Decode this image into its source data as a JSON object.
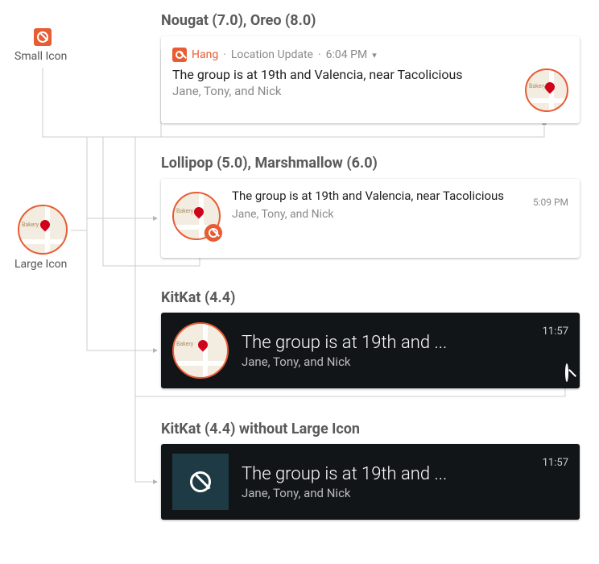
{
  "labels": {
    "small_icon": "Small Icon",
    "large_icon": "Large Icon"
  },
  "headings": {
    "nougat": "Nougat (7.0), Oreo (8.0)",
    "lollipop": "Lollipop (5.0), Marshmallow (6.0)",
    "kitkat": "KitKat (4.4)",
    "kitkat_no_large": "KitKat (4.4) without Large Icon"
  },
  "card_nougat": {
    "app_name": "Hang",
    "category": "Location Update",
    "time": "6:04 PM",
    "title": "The group is at 19th and Valencia, near Tacolicious",
    "subtitle": "Jane, Tony, and Nick",
    "sep": "·"
  },
  "card_lollipop": {
    "title": "The group is at 19th and Valencia, near Tacolicious",
    "subtitle": "Jane, Tony, and Nick",
    "time": "5:09 PM"
  },
  "card_kitkat": {
    "title": "The group is at 19th and ...",
    "subtitle": "Jane, Tony, and Nick",
    "time": "11:57"
  },
  "card_kitkat_no_large": {
    "title": "The group is at 19th and ...",
    "subtitle": "Jane, Tony, and Nick",
    "time": "11:57"
  },
  "map": {
    "label": "Bakery"
  }
}
